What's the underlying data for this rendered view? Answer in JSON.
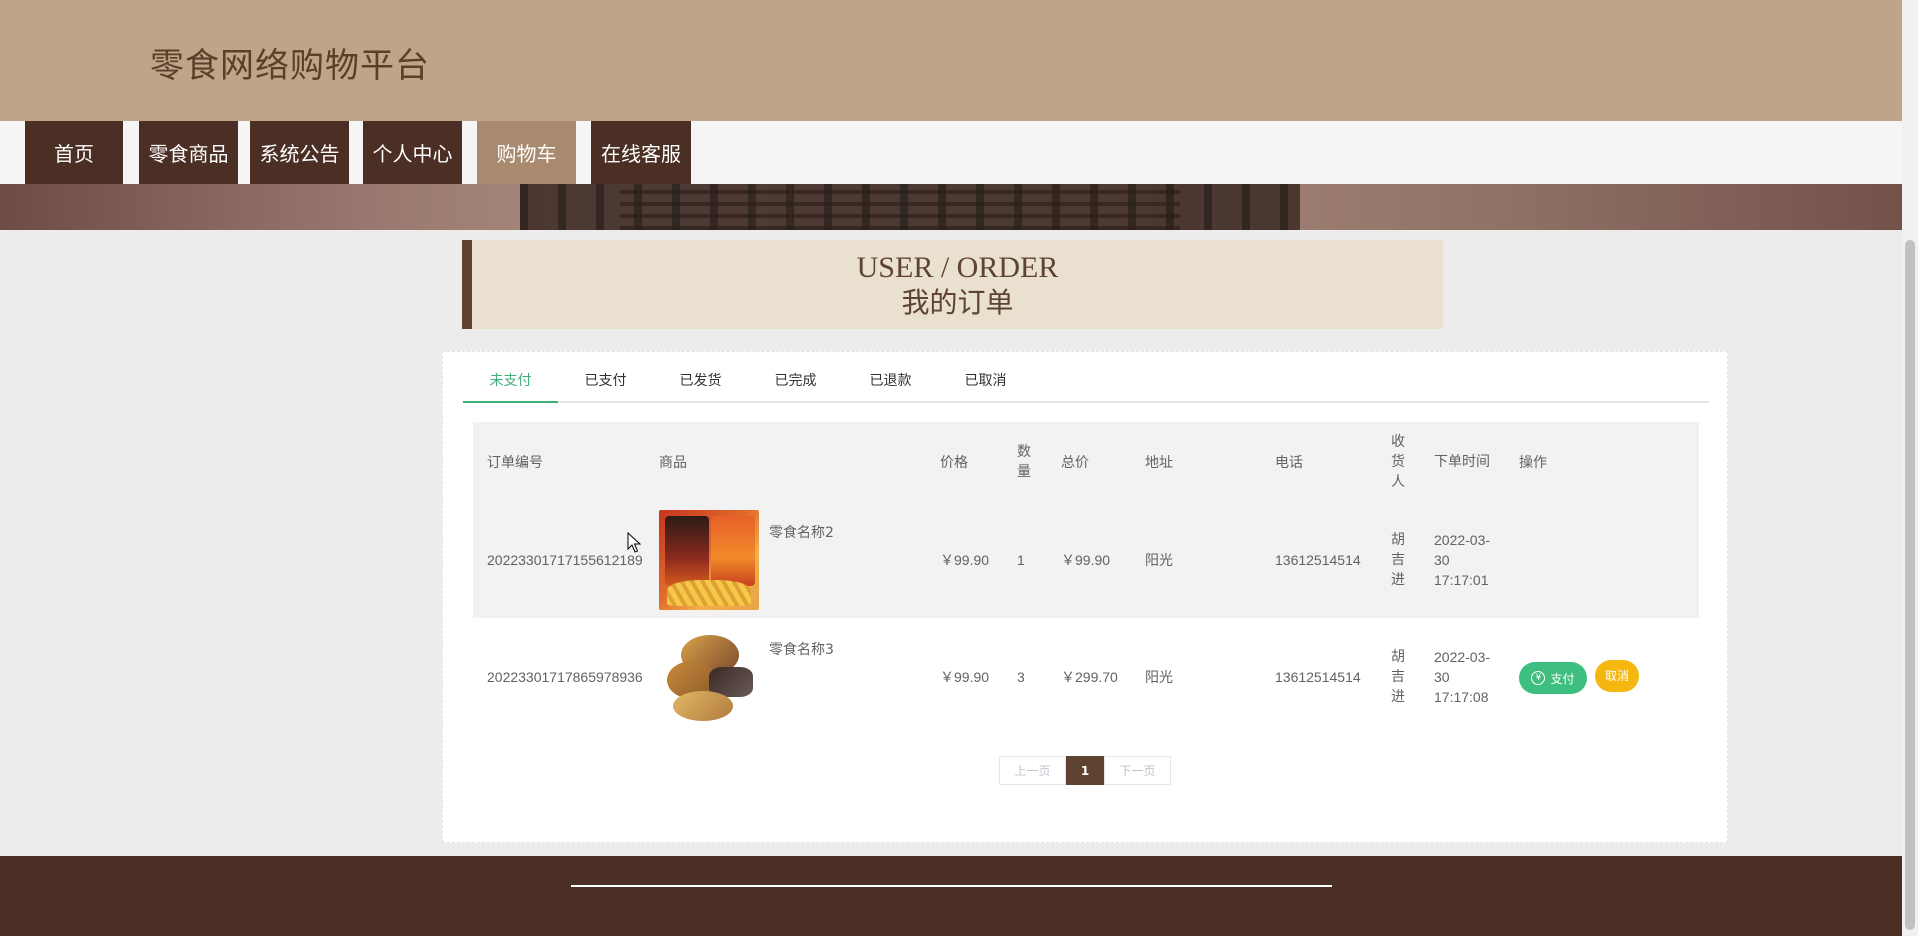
{
  "site": {
    "title": "零食网络购物平台"
  },
  "nav": [
    {
      "label": "首页"
    },
    {
      "label": "零食商品"
    },
    {
      "label": "系统公告"
    },
    {
      "label": "个人中心"
    },
    {
      "label": "购物车"
    },
    {
      "label": "在线客服"
    }
  ],
  "nav_active": "购物车",
  "order_header": {
    "en": "USER / ORDER",
    "cn": "我的订单"
  },
  "tabs": [
    {
      "label": "未支付"
    },
    {
      "label": "已支付"
    },
    {
      "label": "已发货"
    },
    {
      "label": "已完成"
    },
    {
      "label": "已退款"
    },
    {
      "label": "已取消"
    }
  ],
  "active_tab": "未支付",
  "table": {
    "headers": [
      "订单编号",
      "商品",
      "价格",
      "数量",
      "总价",
      "地址",
      "电话",
      "收货人",
      "下单时间",
      "操作"
    ],
    "rows": [
      {
        "order_no": "20223301717155612189",
        "goods_name": "零食名称2",
        "price": "￥99.90",
        "quantity": "1",
        "total": "￥99.90",
        "address": "阳光",
        "phone": "13612514514",
        "receiver": "胡吉进",
        "time": "2022-03-30 17:17:01"
      },
      {
        "order_no": "20223301717865978936",
        "goods_name": "零食名称3",
        "price": "￥99.90",
        "quantity": "3",
        "total": "￥299.70",
        "address": "阳光",
        "phone": "13612514514",
        "receiver": "胡吉进",
        "time": "2022-03-30 17:17:08",
        "actions": {
          "pay": "支付",
          "cancel": "取消"
        }
      }
    ]
  },
  "pagination": {
    "prev": "上一页",
    "current": "1",
    "next": "下一页"
  },
  "colors": {
    "header_bg": "#bfa488",
    "nav_bg": "#4b2e24",
    "nav_active_bg": "#a98a6f",
    "accent_green": "#3fae7a",
    "pay_button": "#3fbf7f",
    "cancel_button": "#f5b60f",
    "footer_bg": "#4b2e24"
  }
}
